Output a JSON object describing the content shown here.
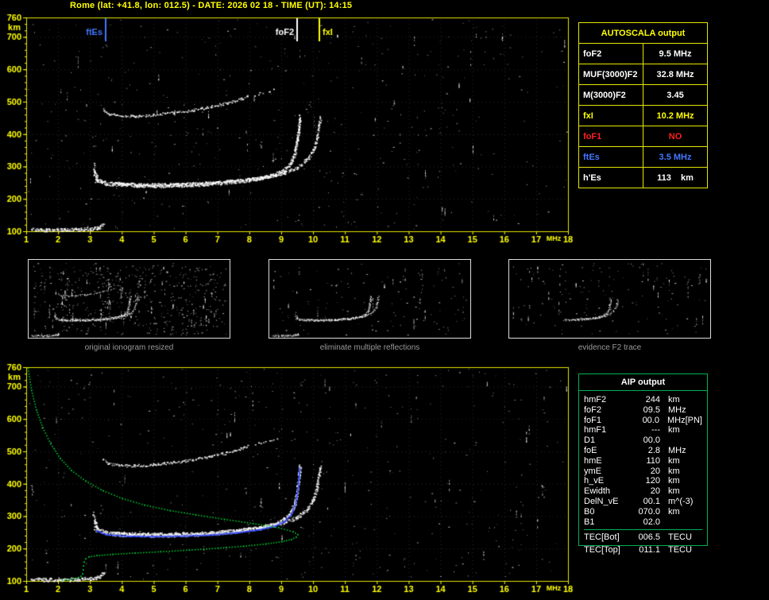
{
  "header": {
    "title": "Rome (lat: +41.8, lon: 012.5) - DATE: 2026 02 18 - TIME (UT): 14:15"
  },
  "autoscala": {
    "title": "AUTOSCALA output",
    "rows": [
      {
        "param": "foF2",
        "value": "9.5 MHz",
        "colorClass": "c-white"
      },
      {
        "param": "MUF(3000)F2",
        "value": "32.8 MHz",
        "colorClass": "c-white"
      },
      {
        "param": "M(3000)F2",
        "value": "3.45",
        "colorClass": "c-white"
      },
      {
        "param": "fxI",
        "value": "10.2 MHz",
        "colorClass": "c-yellow"
      },
      {
        "param": "foF1",
        "value": "NO",
        "colorClass": "c-red"
      },
      {
        "param": "ftEs",
        "value": "3.5 MHz",
        "colorClass": "c-blue"
      },
      {
        "param": "h'Es",
        "value": "113    km",
        "colorClass": "c-white"
      }
    ]
  },
  "aip": {
    "title": "AIP output",
    "rows": [
      {
        "name": "hmF2",
        "value": "244",
        "unit": "km",
        "extra": ""
      },
      {
        "name": "foF2",
        "value": "09.5",
        "unit": "MHz",
        "extra": ""
      },
      {
        "name": "foF1",
        "value": "00.0",
        "unit": "MHz",
        "extra": "[PN]"
      },
      {
        "name": "hmF1",
        "value": "---",
        "unit": "km",
        "extra": ""
      },
      {
        "name": "D1",
        "value": "00.0",
        "unit": "",
        "extra": ""
      },
      {
        "name": "foE",
        "value": "2.8",
        "unit": "MHz",
        "extra": ""
      },
      {
        "name": "hmE",
        "value": "110",
        "unit": "km",
        "extra": ""
      },
      {
        "name": "ymE",
        "value": "20",
        "unit": "km",
        "extra": ""
      },
      {
        "name": "h_vE",
        "value": "120",
        "unit": "km",
        "extra": ""
      },
      {
        "name": "Ewidth",
        "value": "20",
        "unit": "km",
        "extra": ""
      },
      {
        "name": "DelN_vE",
        "value": "00.1",
        "unit": "m^(-3)",
        "extra": ""
      },
      {
        "name": "B0",
        "value": "070.0",
        "unit": "km",
        "extra": ""
      },
      {
        "name": "B1",
        "value": "02.0",
        "unit": "",
        "extra": ""
      }
    ],
    "tec_rows": [
      {
        "name": "TEC[Bot]",
        "value": "006.5",
        "unit": "TECU"
      },
      {
        "name": "TEC[Top]",
        "value": "011.1",
        "unit": "TECU"
      }
    ]
  },
  "thumbs": [
    {
      "caption": "original ionogram resized"
    },
    {
      "caption": "eliminate multiple reflections"
    },
    {
      "caption": "evidence F2 trace"
    }
  ],
  "chart_data": {
    "type": "scatter",
    "title": "Rome ionogram 2026-02-18 14:15 UT with AUTOSCALA scaling",
    "xlabel": "MHz",
    "ylabel": "km",
    "xlim": [
      1,
      18
    ],
    "ylim": [
      100,
      760
    ],
    "xticks": [
      1,
      2,
      3,
      4,
      5,
      6,
      7,
      8,
      9,
      10,
      11,
      12,
      13,
      14,
      15,
      16,
      17,
      18
    ],
    "yticks": [
      100,
      200,
      300,
      400,
      500,
      600,
      700,
      760
    ],
    "grid": "faint dotted at each MHz and each 100 km",
    "markers": [
      {
        "label": "ftEs",
        "freq": 3.5,
        "color": "#4477ff",
        "side": "left"
      },
      {
        "label": "foF2",
        "freq": 9.5,
        "color": "#ffffff",
        "side": "left"
      },
      {
        "label": "fxI",
        "freq": 10.2,
        "color": "#ffff00",
        "side": "right"
      }
    ],
    "traces": {
      "es": {
        "color": "#ffffff",
        "style": "scatter",
        "thick": 2.2,
        "density": 2.2,
        "pts": [
          [
            1.15,
            106
          ],
          [
            1.6,
            105
          ],
          [
            2.1,
            105
          ],
          [
            2.6,
            106
          ],
          [
            3.0,
            109
          ],
          [
            3.2,
            111
          ],
          [
            3.32,
            114
          ],
          [
            3.4,
            124
          ]
        ]
      },
      "start_smear": {
        "color": "#ffffff",
        "style": "scatter",
        "thick": 1.5,
        "density": 0.8,
        "pts": [
          [
            3.16,
            252
          ],
          [
            3.12,
            285
          ],
          [
            3.1,
            312
          ]
        ]
      },
      "f_o": {
        "color": "#ffffff",
        "style": "scatter",
        "thick": 2.4,
        "density": 2.6,
        "pts": [
          [
            3.14,
            282
          ],
          [
            3.22,
            260
          ],
          [
            3.5,
            249
          ],
          [
            4.0,
            244
          ],
          [
            5.0,
            242
          ],
          [
            6.0,
            244
          ],
          [
            6.8,
            248
          ],
          [
            7.6,
            255
          ],
          [
            8.3,
            264
          ],
          [
            8.8,
            276
          ],
          [
            9.1,
            291
          ],
          [
            9.3,
            313
          ],
          [
            9.42,
            343
          ],
          [
            9.5,
            386
          ],
          [
            9.55,
            426
          ],
          [
            9.58,
            456
          ]
        ]
      },
      "f_x": {
        "color": "#ffffff",
        "style": "scatter",
        "thick": 2.0,
        "density": 1.8,
        "pts": [
          [
            3.7,
            249
          ],
          [
            4.5,
            246
          ],
          [
            5.5,
            245
          ],
          [
            6.5,
            248
          ],
          [
            7.3,
            254
          ],
          [
            8.0,
            261
          ],
          [
            8.6,
            270
          ],
          [
            9.1,
            282
          ],
          [
            9.5,
            298
          ],
          [
            9.8,
            322
          ],
          [
            10.0,
            352
          ],
          [
            10.12,
            392
          ],
          [
            10.18,
            428
          ],
          [
            10.22,
            452
          ]
        ]
      },
      "hop2": {
        "color": "#ffffff",
        "style": "scatter",
        "thick": 1.6,
        "density": 1.1,
        "pts": [
          [
            3.38,
            476
          ],
          [
            3.55,
            464
          ],
          [
            3.9,
            458
          ],
          [
            4.4,
            457
          ],
          [
            5.0,
            461
          ],
          [
            5.6,
            467
          ],
          [
            6.2,
            475
          ],
          [
            6.8,
            486
          ],
          [
            7.3,
            497
          ],
          [
            7.7,
            508
          ],
          [
            7.95,
            517
          ]
        ]
      },
      "hop2_tail": {
        "color": "#ffffff",
        "style": "scatter",
        "thick": 1.2,
        "density": 0.35,
        "pts": [
          [
            8.1,
            521
          ],
          [
            8.5,
            531
          ],
          [
            8.85,
            540
          ]
        ]
      },
      "f2_right_o": {
        "color": "#ffffff",
        "style": "scatter",
        "thick": 2.2,
        "density": 2.2,
        "pts": [
          [
            5.6,
            244
          ],
          [
            6.8,
            248
          ],
          [
            7.6,
            255
          ],
          [
            8.3,
            264
          ],
          [
            8.8,
            276
          ],
          [
            9.1,
            291
          ],
          [
            9.3,
            313
          ],
          [
            9.42,
            343
          ],
          [
            9.5,
            386
          ],
          [
            9.55,
            426
          ]
        ]
      },
      "f2_right_x": {
        "color": "#ffffff",
        "style": "scatter",
        "thick": 1.8,
        "density": 1.5,
        "pts": [
          [
            6.5,
            248
          ],
          [
            7.3,
            254
          ],
          [
            8.0,
            261
          ],
          [
            8.6,
            270
          ],
          [
            9.1,
            282
          ],
          [
            9.5,
            298
          ],
          [
            9.8,
            322
          ],
          [
            10.0,
            352
          ],
          [
            10.12,
            392
          ],
          [
            10.18,
            428
          ]
        ]
      }
    },
    "profile": {
      "name": "AIP electron density profile",
      "color": "#00cc33",
      "style": "dots",
      "pts": [
        [
          1.04,
          758
        ],
        [
          1.15,
          690
        ],
        [
          1.3,
          630
        ],
        [
          1.5,
          575
        ],
        [
          1.75,
          525
        ],
        [
          2.05,
          480
        ],
        [
          2.4,
          443
        ],
        [
          2.85,
          410
        ],
        [
          3.4,
          380
        ],
        [
          4.0,
          356
        ],
        [
          4.7,
          336
        ],
        [
          5.5,
          319
        ],
        [
          6.3,
          306
        ],
        [
          7.2,
          292
        ],
        [
          8.1,
          279
        ],
        [
          8.9,
          266
        ],
        [
          9.35,
          254
        ],
        [
          9.5,
          245
        ],
        [
          9.45,
          237
        ],
        [
          9.3,
          230
        ],
        [
          9.0,
          223
        ],
        [
          8.5,
          216
        ],
        [
          7.8,
          209
        ],
        [
          7.0,
          203
        ],
        [
          6.1,
          197
        ],
        [
          5.2,
          192
        ],
        [
          4.4,
          188
        ],
        [
          3.7,
          184
        ],
        [
          3.2,
          180
        ],
        [
          2.95,
          176
        ],
        [
          2.85,
          170
        ],
        [
          2.8,
          160
        ],
        [
          2.78,
          148
        ],
        [
          2.77,
          136
        ],
        [
          2.75,
          124
        ],
        [
          2.7,
          116
        ],
        [
          2.55,
          110
        ],
        [
          2.35,
          106
        ],
        [
          2.1,
          103
        ]
      ]
    },
    "fit": {
      "name": "restored F2 trace fit",
      "color": "#2e46ff",
      "style": "line",
      "pts": [
        [
          3.2,
          256
        ],
        [
          3.5,
          245
        ],
        [
          4.2,
          240
        ],
        [
          5.0,
          239
        ],
        [
          6.0,
          241
        ],
        [
          6.8,
          244
        ],
        [
          7.6,
          251
        ],
        [
          8.3,
          260
        ],
        [
          8.8,
          272
        ],
        [
          9.1,
          287
        ],
        [
          9.3,
          308
        ],
        [
          9.42,
          338
        ],
        [
          9.5,
          380
        ],
        [
          9.54,
          422
        ],
        [
          9.56,
          450
        ]
      ]
    },
    "panels": {
      "top": {
        "use": [
          "es",
          "start_smear",
          "f_o",
          "f_x",
          "hop2",
          "hop2_tail"
        ],
        "noise": {
          "seed": 7,
          "dots": 420,
          "streaks": 42
        },
        "show_markers": true
      },
      "bottom": {
        "use": [
          "es",
          "start_smear",
          "f_o",
          "f_x",
          "hop2",
          "hop2_tail"
        ],
        "noise": {
          "seed": 13,
          "dots": 420,
          "streaks": 42
        },
        "show_markers": false,
        "overlays": [
          "fit",
          "profile"
        ]
      },
      "thumbs": [
        {
          "use": [
            "es",
            "start_smear",
            "f_o",
            "f_x",
            "hop2",
            "hop2_tail"
          ],
          "noise": {
            "seed": 3,
            "dots": 520,
            "streaks": 60
          }
        },
        {
          "use": [
            "es",
            "start_smear",
            "f_o",
            "f_x"
          ],
          "noise": {
            "seed": 4,
            "dots": 120,
            "streaks": 16
          }
        },
        {
          "use": [
            "f2_right_o",
            "f2_right_x"
          ],
          "noise": {
            "seed": 5,
            "dots": 140,
            "streaks": 22
          }
        }
      ]
    }
  }
}
